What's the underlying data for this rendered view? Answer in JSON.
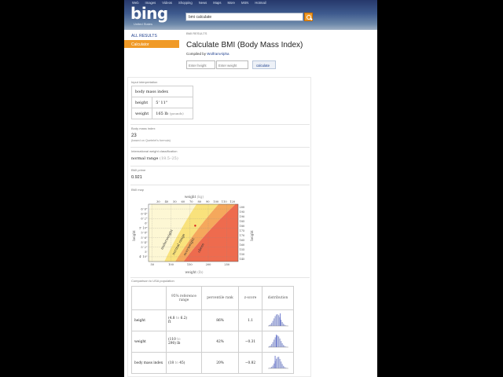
{
  "header": {
    "nav": [
      "Web",
      "Images",
      "Videos",
      "Shopping",
      "News",
      "Maps",
      "More",
      "MSN",
      "Hotmail"
    ],
    "logo": "bing",
    "logo_sub": "United States",
    "search_value": "bmi calculate"
  },
  "sidebar": {
    "items": [
      "ALL RESULTS",
      "Calculator"
    ]
  },
  "main": {
    "results_label": "BMI RESULTS",
    "title": "Calculate BMI (Body Mass Index)",
    "compiled_prefix": "Compiled by",
    "compiled_link": "WolframAlpha",
    "height_placeholder": "Enter height",
    "weight_placeholder": "Enter weight",
    "calculate_label": "calculate"
  },
  "pods": {
    "interp": {
      "title": "Input interpretation",
      "header": "body mass index",
      "rows": [
        {
          "label": "height",
          "value": "5' 11\"",
          "unit": ""
        },
        {
          "label": "weight",
          "value": "165 lb",
          "unit": "(pounds)"
        }
      ]
    },
    "bmi": {
      "title": "Body mass index",
      "value": "23",
      "note": "(based on Quetelet's formula)"
    },
    "classification": {
      "title": "International weight classification",
      "value": "normal range",
      "range": "(18.5–25)"
    },
    "prime": {
      "title": "BMI prime",
      "value": "0.921"
    },
    "map": {
      "title": "BMI map",
      "top_axis_label": "weight",
      "top_axis_unit": "(kg)",
      "top_ticks": [
        "30",
        "40",
        "50",
        "60",
        "70",
        "80",
        "90",
        "100",
        "110",
        "120"
      ],
      "bottom_axis_label": "weight",
      "bottom_axis_unit": "(lb)",
      "bottom_ticks": [
        "50",
        "100",
        "150",
        "200",
        "250"
      ],
      "left_axis_label": "height",
      "left_ticks": [
        "6' 6\"",
        "6' 4\"",
        "6' 2\"",
        "6'",
        "5' 10\"",
        "5' 8\"",
        "5' 6\"",
        "5' 4\"",
        "5' 2\"",
        "5'",
        "4' 10\""
      ],
      "right_axis_label": "height",
      "right_ticks": [
        "200",
        "195",
        "190",
        "185",
        "180",
        "175",
        "170",
        "165",
        "160",
        "155",
        "150",
        "145"
      ],
      "regions": [
        "underweight",
        "normal range",
        "overweight",
        "obese"
      ],
      "colors": {
        "underweight": "#fdf7d4",
        "normal": "#f9e27c",
        "overweight": "#f5a85c",
        "obese": "#ee6b4e",
        "marker": "#d7191c"
      },
      "point": {
        "weight_lb": 165,
        "height_in": 71
      }
    },
    "comparison": {
      "title": "Comparison to USA population",
      "headers": [
        "95% reference range",
        "percentile rank",
        "z-score",
        "distribution"
      ],
      "rows": [
        {
          "label": "height",
          "range_open": "(4.8",
          "to": "to",
          "range_close": "6.2)",
          "unit": "ft",
          "percentile": "86%",
          "z": "1.1"
        },
        {
          "label": "weight",
          "range_open": "(110",
          "to": "to",
          "range_close": "290) lb",
          "unit": "",
          "percentile": "42%",
          "z": "−0.31"
        },
        {
          "label": "body mass index",
          "range_open": "(18",
          "to": "to",
          "range_close": "45)",
          "unit": "",
          "percentile": "20%",
          "z": "−0.82"
        }
      ],
      "hist_color": "#9fa8d8",
      "marker_color": "#3b4cc0"
    }
  }
}
